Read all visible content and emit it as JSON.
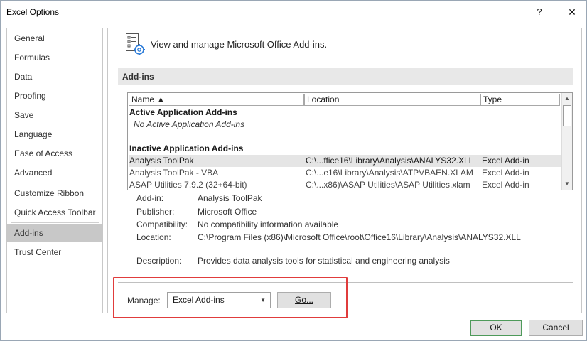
{
  "window": {
    "title": "Excel Options",
    "help_glyph": "?",
    "close_glyph": "✕"
  },
  "sidebar": {
    "items": [
      {
        "label": "General"
      },
      {
        "label": "Formulas"
      },
      {
        "label": "Data"
      },
      {
        "label": "Proofing"
      },
      {
        "label": "Save"
      },
      {
        "label": "Language"
      },
      {
        "label": "Ease of Access"
      },
      {
        "label": "Advanced"
      },
      {
        "label": "Customize Ribbon"
      },
      {
        "label": "Quick Access Toolbar"
      },
      {
        "label": "Add-ins",
        "selected": true
      },
      {
        "label": "Trust Center"
      }
    ]
  },
  "header": {
    "icon": "addins-gear-icon",
    "text": "View and manage Microsoft Office Add-ins."
  },
  "section": {
    "title": "Add-ins"
  },
  "table": {
    "columns": [
      "Name ▲",
      "Location",
      "Type"
    ],
    "active_group": "Active Application Add-ins",
    "active_empty": "No Active Application Add-ins",
    "inactive_group": "Inactive Application Add-ins",
    "rows": [
      {
        "name": "Analysis ToolPak",
        "location": "C:\\...ffice16\\Library\\Analysis\\ANALYS32.XLL",
        "type": "Excel Add-in",
        "selected": true
      },
      {
        "name": "Analysis ToolPak - VBA",
        "location": "C:\\...e16\\Library\\Analysis\\ATPVBAEN.XLAM",
        "type": "Excel Add-in"
      },
      {
        "name": "ASAP Utilities 7.9.2 (32+64-bit)",
        "location": "C:\\...x86)\\ASAP Utilities\\ASAP Utilities.xlam",
        "type": "Excel Add-in"
      }
    ]
  },
  "details": {
    "addin_label": "Add-in:",
    "addin_value": "Analysis ToolPak",
    "publisher_label": "Publisher:",
    "publisher_value": "Microsoft Office",
    "compat_label": "Compatibility:",
    "compat_value": "No compatibility information available",
    "location_label": "Location:",
    "location_value": "C:\\Program Files (x86)\\Microsoft Office\\root\\Office16\\Library\\Analysis\\ANALYS32.XLL",
    "description_label": "Description:",
    "description_value": "Provides data analysis tools for statistical and engineering analysis"
  },
  "manage": {
    "label": "Manage:",
    "selected": "Excel Add-ins",
    "go_label": "Go..."
  },
  "footer": {
    "ok_label": "OK",
    "cancel_label": "Cancel"
  },
  "colors": {
    "highlight_frame": "#e03c3c",
    "ok_border": "#4e9a5a",
    "selected_nav": "#c8c8c8"
  }
}
